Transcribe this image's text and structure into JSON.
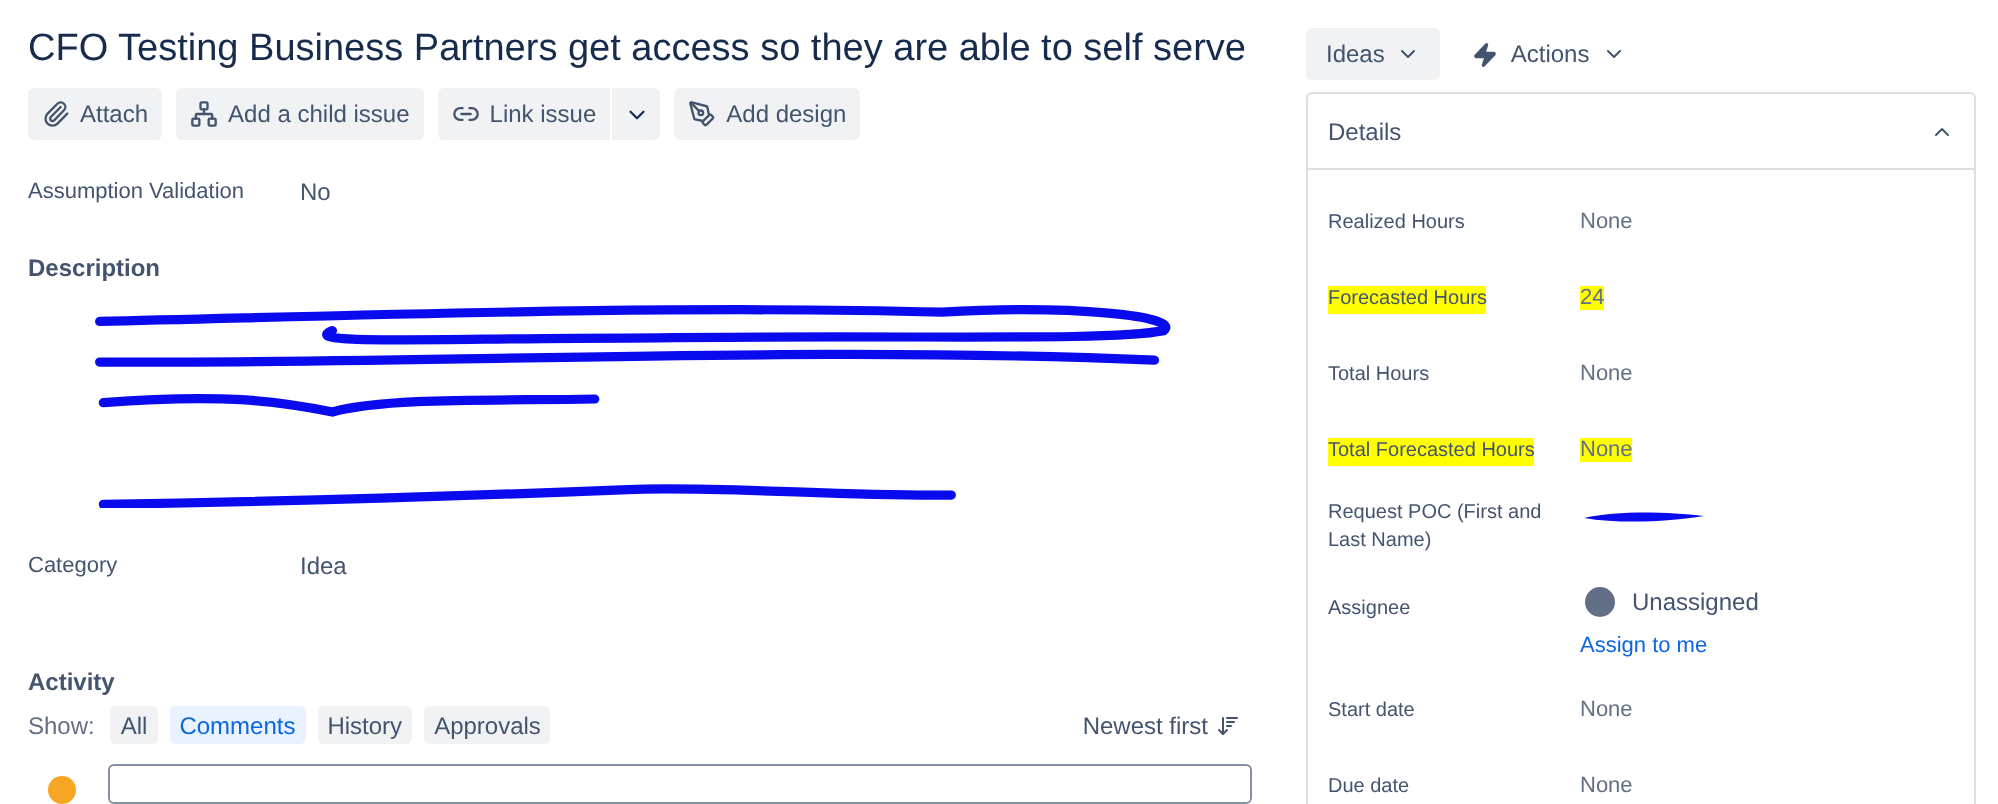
{
  "title": "CFO Testing Business Partners get access so they are able to self serve",
  "toolbar": [
    {
      "label": "Attach",
      "kind": "plain"
    },
    {
      "label": "Add a child issue",
      "kind": "plain"
    },
    {
      "label": "Link issue",
      "kind": "split"
    },
    {
      "label": "Add design",
      "kind": "plain"
    }
  ],
  "fields_top": [
    {
      "label": "Assumption Validation",
      "value": "No"
    }
  ],
  "description": {
    "heading": "Description"
  },
  "fields_bottom": [
    {
      "label": "Category",
      "value": "Idea"
    }
  ],
  "activity": {
    "heading": "Activity",
    "show_label": "Show:",
    "filters": [
      {
        "label": "All",
        "selected": false
      },
      {
        "label": "Comments",
        "selected": true
      },
      {
        "label": "History",
        "selected": false
      },
      {
        "label": "Approvals",
        "selected": false
      }
    ],
    "sort": "Newest first"
  },
  "header_actions": [
    {
      "label": "Ideas",
      "kind": "status"
    },
    {
      "label": "Actions",
      "kind": "menu"
    }
  ],
  "details": {
    "title": "Details",
    "expanded": true,
    "rows": [
      {
        "label": "Realized Hours",
        "value": "None",
        "kind": "text",
        "highlighted": false
      },
      {
        "label": "Forecasted Hours",
        "value": "24",
        "kind": "text",
        "highlighted": true
      },
      {
        "label": "Total Hours",
        "value": "None",
        "kind": "text",
        "highlighted": false
      },
      {
        "label": "Total Forecasted Hours",
        "value": "None",
        "kind": "text",
        "highlighted": true
      },
      {
        "label": "Request POC (First and Last Name)",
        "kind": "redacted",
        "highlighted": false
      },
      {
        "label": "Assignee",
        "value": "Unassigned",
        "link": "Assign to me",
        "kind": "user",
        "highlighted": false
      },
      {
        "label": "Start date",
        "value": "None",
        "kind": "text",
        "highlighted": false
      },
      {
        "label": "Due date",
        "value": "None",
        "kind": "text",
        "highlighted": false
      }
    ]
  }
}
